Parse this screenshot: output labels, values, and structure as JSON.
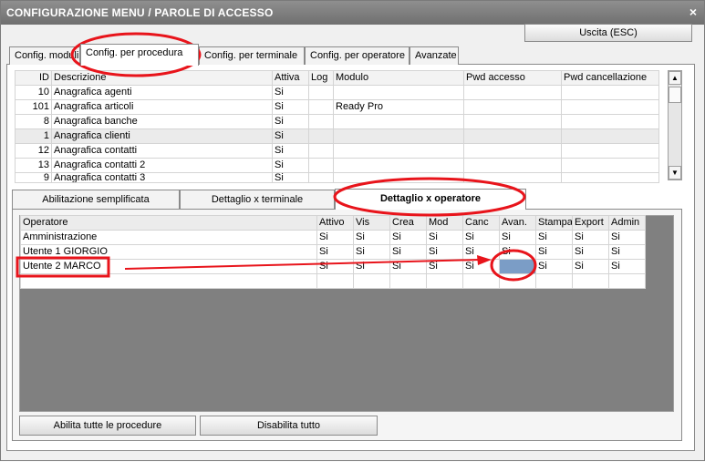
{
  "window": {
    "title": "CONFIGURAZIONE MENU / PAROLE DI ACCESSO",
    "close_glyph": "×"
  },
  "exit_button": "Uscita (ESC)",
  "top_tabs": [
    "Config. moduli",
    "Config. per procedura",
    "Config. per terminale",
    "Config. per operatore",
    "Avanzate"
  ],
  "procedures_table": {
    "columns": [
      "ID",
      "Descrizione",
      "Attiva",
      "Log",
      "Modulo",
      "Pwd accesso",
      "Pwd cancellazione"
    ],
    "rows": [
      [
        "10",
        "Anagrafica agenti",
        "Si",
        "",
        "",
        "",
        ""
      ],
      [
        "101",
        "Anagrafica articoli",
        "Si",
        "",
        "Ready Pro",
        "",
        ""
      ],
      [
        "8",
        "Anagrafica banche",
        "Si",
        "",
        "",
        "",
        ""
      ],
      [
        "1",
        "Anagrafica clienti",
        "Si",
        "",
        "",
        "",
        ""
      ],
      [
        "12",
        "Anagrafica contatti",
        "Si",
        "",
        "",
        "",
        ""
      ],
      [
        "13",
        "Anagrafica contatti 2",
        "Si",
        "",
        "",
        "",
        ""
      ],
      [
        "9",
        "Anagrafica contatti 3",
        "Si",
        "",
        "",
        "",
        ""
      ]
    ]
  },
  "scroll_arrows": {
    "up": "▲",
    "down": "▼"
  },
  "bottom_tabs": [
    "Abilitazione semplificata",
    "Dettaglio x terminale",
    "Dettaglio x operatore"
  ],
  "operators_table": {
    "columns": [
      "Operatore",
      "Attivo",
      "Vis",
      "Crea",
      "Mod",
      "Canc",
      "Avan.",
      "Stampa",
      "Export",
      "Admin"
    ],
    "rows": [
      [
        "Amministrazione",
        "Si",
        "Si",
        "Si",
        "Si",
        "Si",
        "Si",
        "Si",
        "Si",
        "Si"
      ],
      [
        "Utente 1 GIORGIO",
        "Si",
        "Si",
        "Si",
        "Si",
        "Si",
        "Si",
        "Si",
        "Si",
        "Si"
      ],
      [
        "Utente 2 MARCO",
        "Si",
        "Si",
        "Si",
        "Si",
        "Si",
        "",
        "Si",
        "Si",
        "Si"
      ]
    ]
  },
  "buttons": {
    "enable_all": "Abilita tutte le procedure",
    "disable_all": "Disabilita tutto"
  },
  "colors": {
    "annotation": "#e8141b",
    "selected_cell": "#7b9dc6",
    "titlebar": "#7f7f7f"
  }
}
